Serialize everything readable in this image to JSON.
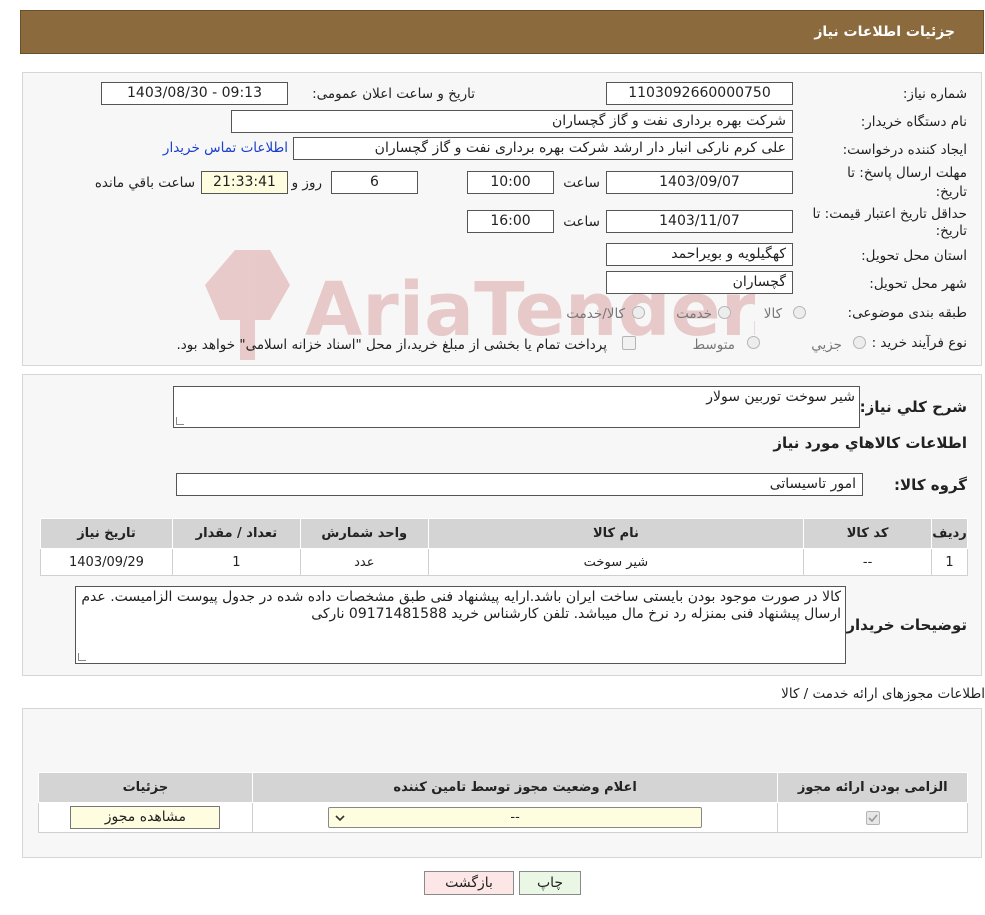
{
  "header": {
    "title": "جزئیات اطلاعات نیاز"
  },
  "form": {
    "need_number_label": "شماره نیاز:",
    "need_number": "1103092660000750",
    "announce_label": "تاریخ و ساعت اعلان عمومی:",
    "announce_value": "1403/08/30 - 09:13",
    "buyer_label": "نام دستگاه خریدار:",
    "buyer_value": "شرکت بهره برداری نفت و گاز گچساران",
    "creator_label": "ایجاد کننده درخواست:",
    "creator_value": "علی کرم نارکی انبار دار ارشد شرکت بهره برداری نفت و گاز گچساران",
    "contact_link": "اطلاعات تماس خریدار",
    "deadline_label": "مهلت ارسال پاسخ: تا تاریخ:",
    "deadline_date": "1403/09/07",
    "time_label": "ساعت",
    "deadline_time": "10:00",
    "days_value": "6",
    "days_label": "روز و",
    "remaining_time": "21:33:41",
    "remaining_label": "ساعت باقي مانده",
    "validity_label": "حداقل تاریخ اعتبار قیمت: تا تاریخ:",
    "validity_date": "1403/11/07",
    "validity_time": "16:00",
    "province_label": "استان محل تحویل:",
    "province_value": "کهگیلویه و بویراحمد",
    "city_label": "شهر محل تحویل:",
    "city_value": "گچساران",
    "category_label": "طبقه بندی موضوعی:",
    "category_options": [
      "کالا",
      "خدمت",
      "کالا/خدمت"
    ],
    "process_label": "نوع فرآیند خرید :",
    "process_options": [
      "جزیي",
      "متوسط"
    ],
    "process_note": "پرداخت تمام یا بخشی از مبلغ خرید،از محل \"اسناد خزانه اسلامی\" خواهد بود."
  },
  "details": {
    "summary_label": "شرح كلي نياز:",
    "summary_value": "شیر سوخت توربین سولار",
    "goods_title": "اطلاعات كالاهاي مورد نياز",
    "group_label": "گروه کالا:",
    "group_value": "امور تاسیساتی",
    "table": {
      "headers": [
        "رديف",
        "کد کالا",
        "نام کالا",
        "واحد شمارش",
        "تعداد / مقدار",
        "تاریخ نیاز"
      ],
      "rows": [
        [
          "1",
          "--",
          "شیر سوخت",
          "عدد",
          "1",
          "1403/09/29"
        ]
      ]
    },
    "notes_label": "توضیحات خریدار:",
    "notes_value": "کالا در صورت موجود بودن بایستی ساخت ایران باشد.ارایه پیشنهاد فنی طبق مشخصات داده شده در جدول پیوست الزامیست. عدم ارسال پیشنهاد فنی بمنزله رد نرخ مال میباشد. تلفن کارشناس خرید 09171481588 نارکی"
  },
  "permits": {
    "title": "اطلاعات مجوزهای ارائه خدمت / کالا",
    "headers": [
      "الزامی بودن ارائه مجوز",
      "اعلام وضعیت مجوز توسط تامین کننده",
      "جزئیات"
    ],
    "select_value": "--",
    "view_button": "مشاهده مجوز"
  },
  "buttons": {
    "print": "چاپ",
    "back": "بازگشت"
  },
  "watermark": {
    "text": "AriaTender.neT"
  },
  "colors": {
    "header_bg": "#8b6a3e",
    "panel_bg": "#f7f7f7",
    "link": "#1a3fcc",
    "yellow_field": "#fffde0",
    "back_button": "#fde6e6",
    "print_button": "#eaf7e4"
  }
}
